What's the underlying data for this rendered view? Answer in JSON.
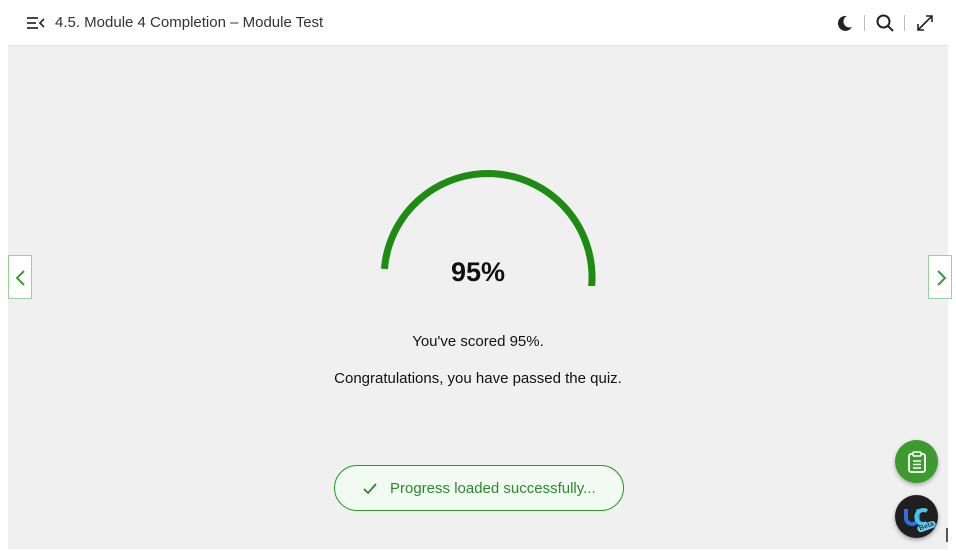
{
  "header": {
    "title": "4.5. Module 4 Completion – Module Test",
    "icons": [
      "menu-collapse-icon",
      "moon-icon",
      "search-icon",
      "expand-icon"
    ]
  },
  "result": {
    "score_percent": 95,
    "score_label": "95%",
    "scored_message": "You've scored 95%.",
    "passed_message": "Congratulations, you have passed the quiz.",
    "gauge_color": "#1e8c12"
  },
  "toast": {
    "message": "Progress loaded successfully...",
    "icon": "check-icon",
    "color": "#2a9a2a"
  },
  "navigation": {
    "prev_icon": "chevron-left-icon",
    "next_icon": "chevron-right-icon"
  },
  "floating_actions": {
    "notes_icon": "clipboard-icon",
    "app_icon": "app-logo-icon",
    "app_badge": "Beta"
  }
}
